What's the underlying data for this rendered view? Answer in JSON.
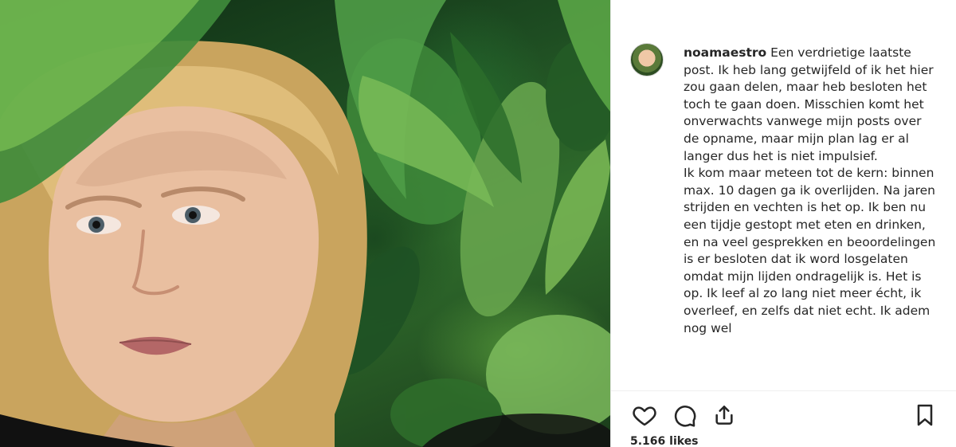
{
  "post": {
    "username": "noamaestro",
    "caption": "Een verdrietige laatste post. Ik heb lang getwijfeld of ik het hier zou gaan delen, maar heb besloten het toch te gaan doen. Misschien komt het onverwachts vanwege mijn posts over de opname, maar mijn plan lag er al langer dus het is niet impulsief.\nIk kom maar meteen tot de kern: binnen max. 10 dagen ga ik overlijden. Na jaren strijden en vechten is het op. Ik ben nu een tijdje gestopt met eten en drinken, en na veel gesprekken en beoordelingen is er besloten dat ik word losgelaten omdat mijn lijden ondragelijk is. Het is op. Ik leef al zo lang niet meer écht, ik overleef, en zelfs dat niet echt. Ik adem nog wel",
    "likes": "5.166 likes"
  },
  "icons": {
    "like": "heart-icon",
    "comment": "comment-icon",
    "share": "share-icon",
    "save": "bookmark-icon"
  },
  "colors": {
    "text": "#262626",
    "icon": "#262626",
    "border": "#efefef"
  }
}
